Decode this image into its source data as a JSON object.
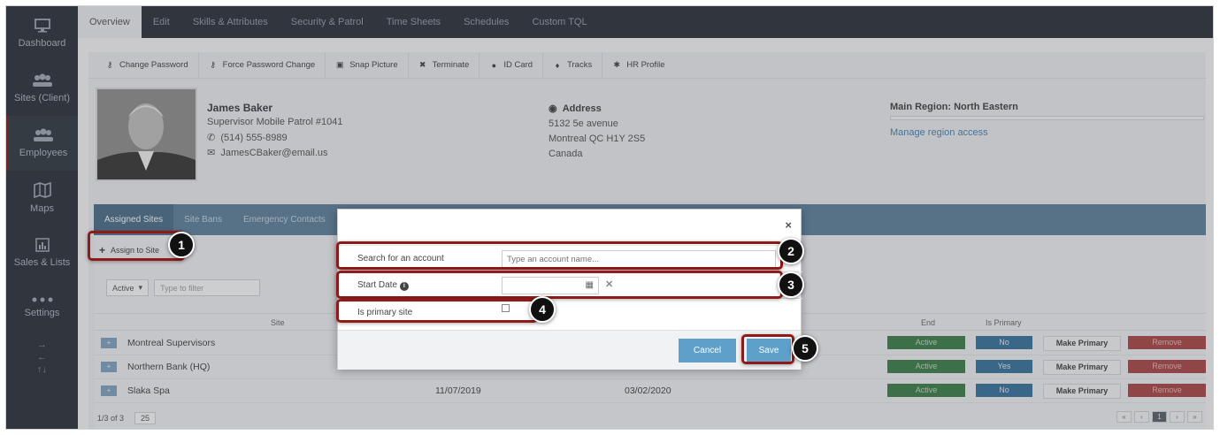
{
  "sidebar": {
    "items": [
      {
        "label": "Dashboard",
        "icon": "monitor-icon"
      },
      {
        "label": "Sites (Client)",
        "icon": "people-icon"
      },
      {
        "label": "Employees",
        "icon": "people-icon"
      },
      {
        "label": "Maps",
        "icon": "map-icon"
      },
      {
        "label": "Sales & Lists",
        "icon": "chart-icon"
      },
      {
        "label": "Settings",
        "icon": "dots-icon"
      }
    ],
    "arrows": [
      "→",
      "←",
      "↑↓"
    ]
  },
  "top_tabs": [
    "Overview",
    "Edit",
    "Skills & Attributes",
    "Security & Patrol",
    "Time Sheets",
    "Schedules",
    "Custom TQL"
  ],
  "toolbar": {
    "items": [
      {
        "label": "Change Password",
        "icon": "key-icon"
      },
      {
        "label": "Force Password Change",
        "icon": "key-icon"
      },
      {
        "label": "Snap Picture",
        "icon": "camera-icon"
      },
      {
        "label": "Terminate",
        "icon": "x-icon"
      },
      {
        "label": "ID Card",
        "icon": "question-icon"
      },
      {
        "label": "Tracks",
        "icon": "pin-icon"
      },
      {
        "label": "HR Profile",
        "icon": "gear-icon"
      }
    ]
  },
  "employee": {
    "name": "James Baker",
    "title": "Supervisor Mobile Patrol #1041",
    "phone": "(514) 555-8989",
    "email": "JamesCBaker@email.us",
    "address_label": "Address",
    "address": [
      "5132 5e avenue",
      "Montreal QC H1Y 2S5",
      "Canada"
    ],
    "region_title": "Main Region: North Eastern",
    "region_link": "Manage region access"
  },
  "sub_tabs": [
    "Assigned Sites",
    "Site Bans",
    "Emergency Contacts"
  ],
  "assign_label": "Assign to Site",
  "filter": {
    "status": "Active",
    "placeholder": "Type to filter"
  },
  "table": {
    "headers": {
      "site": "Site",
      "end": "End",
      "primary": "Is Primary"
    },
    "rows": [
      {
        "site": "Montreal Supervisors",
        "start": "",
        "end": "",
        "status": "Active",
        "primary": "No",
        "make": "Make Primary",
        "remove": "Remove"
      },
      {
        "site": "Northern Bank (HQ)",
        "start": "",
        "end": "",
        "status": "Active",
        "primary": "Yes",
        "make": "Make Primary",
        "remove": "Remove"
      },
      {
        "site": "Slaka Spa",
        "start": "11/07/2019",
        "end": "03/02/2020",
        "status": "Active",
        "primary": "No",
        "make": "Make Primary",
        "remove": "Remove"
      }
    ],
    "count": "1/3 of 3",
    "page_size": "25",
    "current_page": "1"
  },
  "modal": {
    "close": "×",
    "search_label": "Search for an account",
    "search_placeholder": "Type an account name...",
    "start_label": "Start Date",
    "primary_label": "Is primary site",
    "cancel": "Cancel",
    "save": "Save"
  },
  "callouts": [
    "1",
    "2",
    "3",
    "4",
    "5"
  ],
  "colors": {
    "highlight": "#8e1a1a",
    "button": "#5ea0c9",
    "sidebar": "#2f353d"
  }
}
